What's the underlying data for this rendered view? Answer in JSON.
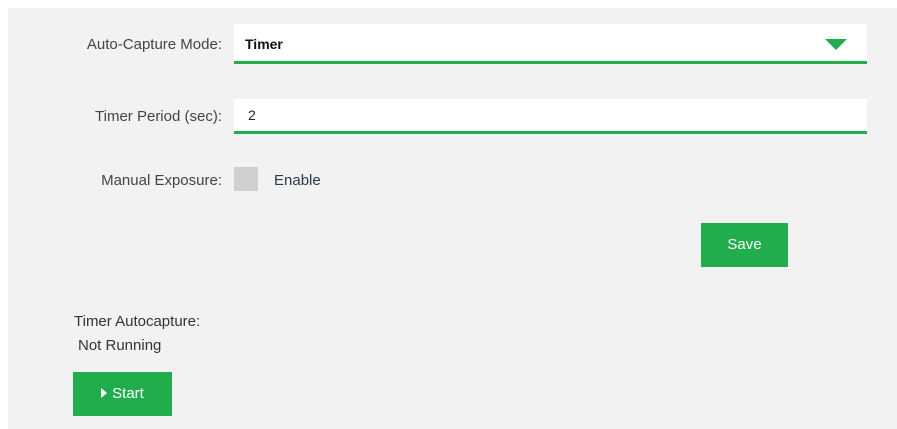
{
  "form": {
    "auto_capture_mode": {
      "label": "Auto-Capture Mode:",
      "value": "Timer"
    },
    "timer_period": {
      "label": "Timer Period (sec):",
      "value": "2"
    },
    "manual_exposure": {
      "label": "Manual Exposure:",
      "checkbox_label": "Enable",
      "checked": false
    },
    "save_label": "Save"
  },
  "autocapture": {
    "title": "Timer Autocapture:",
    "status": "Not Running",
    "start_label": "Start"
  },
  "colors": {
    "accent": "#21ad4b",
    "panel_background": "#f2f2f2",
    "checkbox_unchecked": "#cfcfcf"
  },
  "icons": {
    "dropdown": "triangle-down-icon",
    "start": "play-icon"
  }
}
